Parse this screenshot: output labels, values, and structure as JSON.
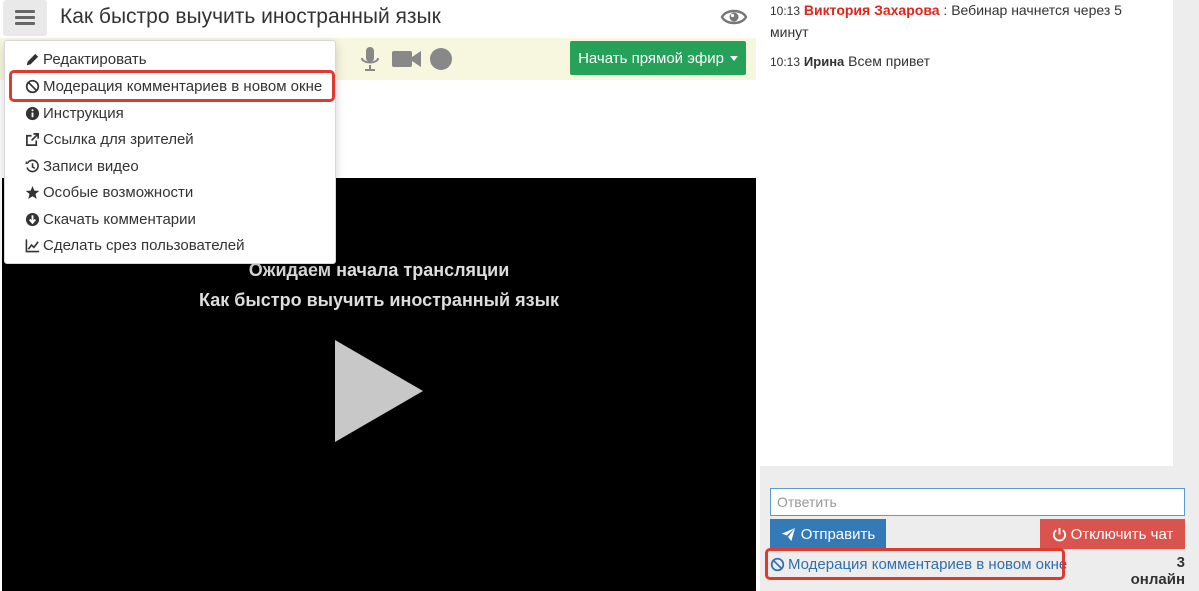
{
  "header": {
    "title": "Как быстро выучить иностранный язык",
    "menu_icon": "hamburger-menu-icon",
    "eye_icon": "eye-icon"
  },
  "toolbar": {
    "mic_icon": "microphone-icon",
    "camera_icon": "video-camera-icon",
    "record_icon": "record-circle-icon",
    "live_button_label": "Начать прямой эфир",
    "live_button_color": "#26a15a"
  },
  "menu": {
    "items": [
      {
        "label": "Редактировать",
        "icon": "pencil-icon"
      },
      {
        "label": "Модерация комментариев в новом окне",
        "icon": "ban-icon"
      },
      {
        "label": "Инструкция",
        "icon": "info-circle-icon"
      },
      {
        "label": "Ссылка для зрителей",
        "icon": "external-link-icon"
      },
      {
        "label": "Записи видео",
        "icon": "history-icon"
      },
      {
        "label": "Особые возможности",
        "icon": "star-icon"
      },
      {
        "label": "Скачать комментарии",
        "icon": "download-circle-icon"
      },
      {
        "label": "Сделать срез пользователей",
        "icon": "line-chart-icon"
      }
    ],
    "highlight_color": "#e0392f"
  },
  "video": {
    "waiting_text": "Ожидаем начала трансляции",
    "title_text": "Как быстро выучить иностранный язык",
    "play_icon": "play-icon"
  },
  "chat": {
    "messages": [
      {
        "time": "10:13",
        "name": "Виктория Захарова",
        "separator": " : ",
        "text": "Вебинар начнется через 5 минут"
      },
      {
        "time": "10:13",
        "name": "Ирина",
        "separator": " ",
        "text": "Всем привет"
      }
    ],
    "reply_placeholder": "Ответить",
    "send_label": "Отправить",
    "disable_label": "Отключить чат",
    "moderation_link": "Модерация комментариев в новом окне",
    "online_count": "3 онлайн",
    "colors": {
      "send": "#337ab7",
      "disable": "#d9534f",
      "link": "#2e6fae",
      "author_highlight": "#e0251b"
    }
  }
}
